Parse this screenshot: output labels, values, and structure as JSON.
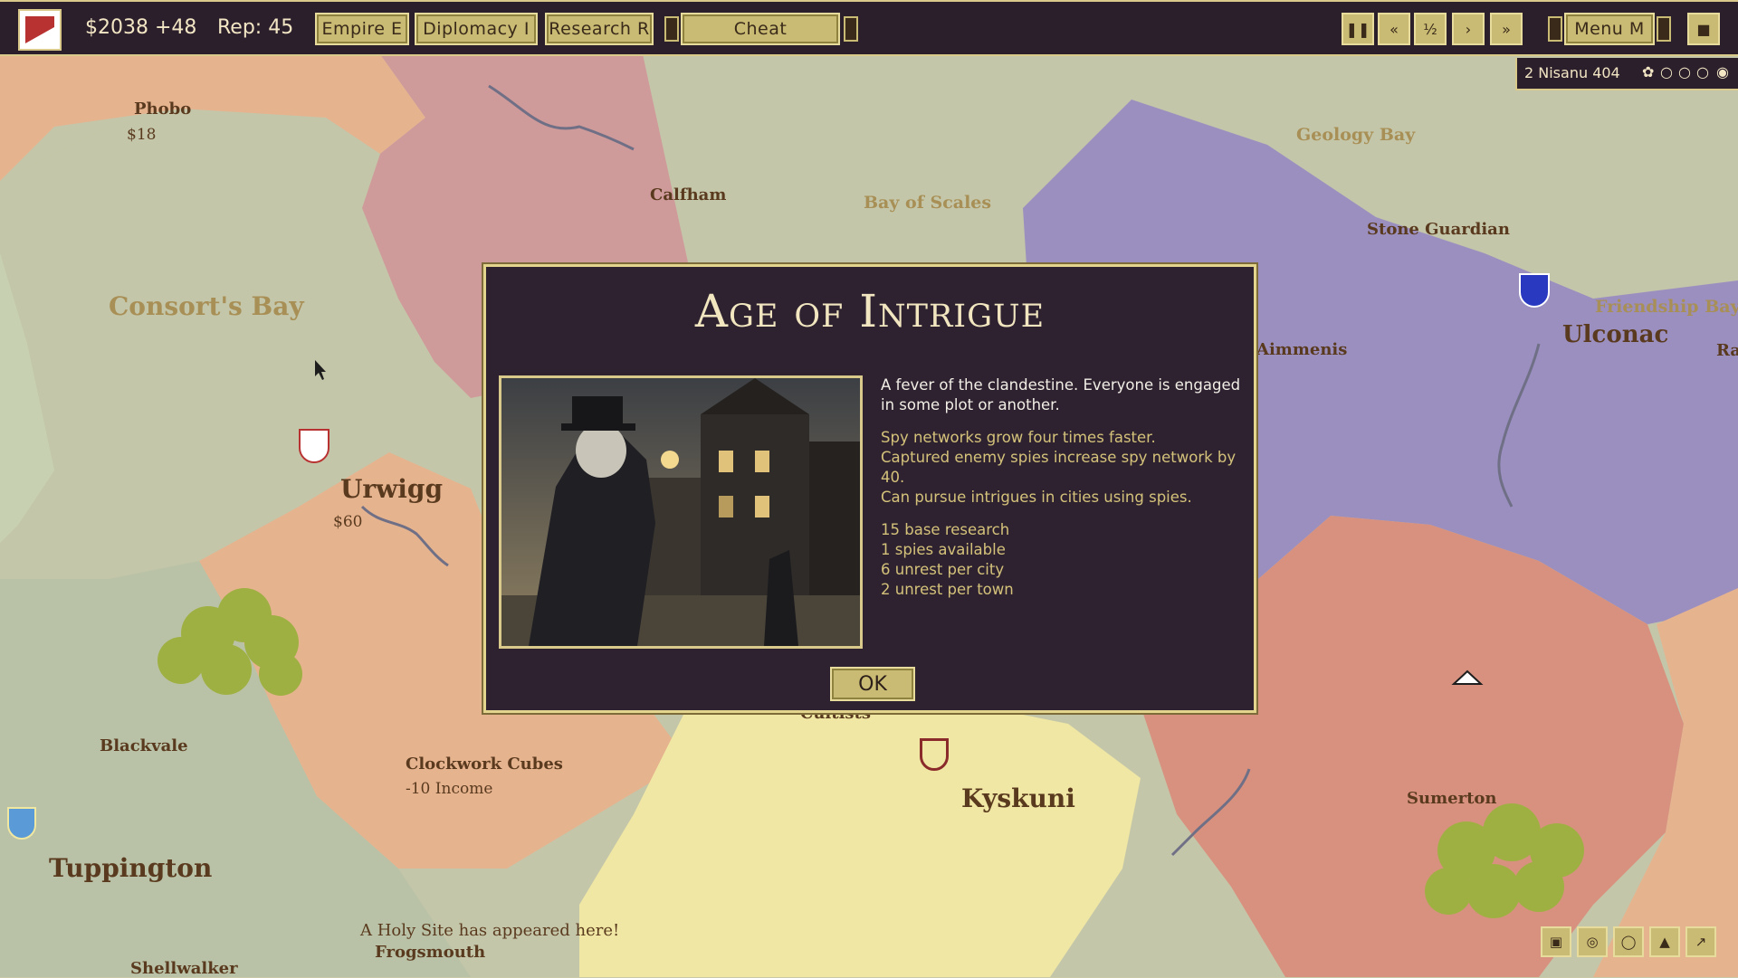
{
  "topbar": {
    "money": "$2038 +48",
    "reputation": "Rep: 45",
    "empire_label": "Empire E",
    "diplomacy_label": "Diplomacy I",
    "research_label": "Research R",
    "cheat_label": "Cheat",
    "menu_label": "Menu M",
    "speed_controls": [
      "pause-icon",
      "slow-icon",
      "half-speed-icon",
      "play-icon",
      "fast-forward-icon"
    ]
  },
  "date": {
    "text": "2 Nisanu 404",
    "moon_icons": [
      "flower-icon",
      "moon-icon",
      "moon-icon",
      "moon-icon",
      "eye-icon"
    ]
  },
  "map": {
    "seas": [
      "Consort's Bay",
      "Bay of Scales",
      "Geology Bay",
      "Friendship Bay"
    ],
    "cities": [
      {
        "name": "Phobo",
        "money": "$18"
      },
      {
        "name": "Calfham"
      },
      {
        "name": "Stone Guardian"
      },
      {
        "name": "Ulconac"
      },
      {
        "name": "Aimmenis"
      },
      {
        "name": "Ra"
      },
      {
        "name": "Urwigg",
        "money": "$60"
      },
      {
        "name": "Blackvale"
      },
      {
        "name": "Clockwork Cubes",
        "money": "-10 Income"
      },
      {
        "name": "Cultists"
      },
      {
        "name": "Kyskuni"
      },
      {
        "name": "Sumerton"
      },
      {
        "name": "Tuppington"
      },
      {
        "name": "Frogsmouth"
      },
      {
        "name": "Shellwalker"
      }
    ],
    "notice": "A Holy Site has appeared here!"
  },
  "modal": {
    "title": "Age of Intrigue",
    "intro": "A fever of the clandestine. Everyone is engaged in some plot or another.",
    "effects": [
      "Spy networks grow four times faster.",
      "Captured enemy spies increase spy network by 40.",
      "Can pursue intrigues in cities using spies."
    ],
    "stats": [
      "15 base research",
      "1 spies available",
      "6 unrest per city",
      "2 unrest per town"
    ],
    "ok_label": "OK"
  },
  "colors": {
    "ui_dark": "#2c1f2c",
    "ui_gold": "#c9bb73",
    "region_pink": "#cf9a9a",
    "region_purple": "#9b8fc0",
    "region_orange": "#e6b38f",
    "region_yellow": "#efe7a3",
    "region_salmon": "#d8917f",
    "land_grey": "#c4c6a9"
  }
}
